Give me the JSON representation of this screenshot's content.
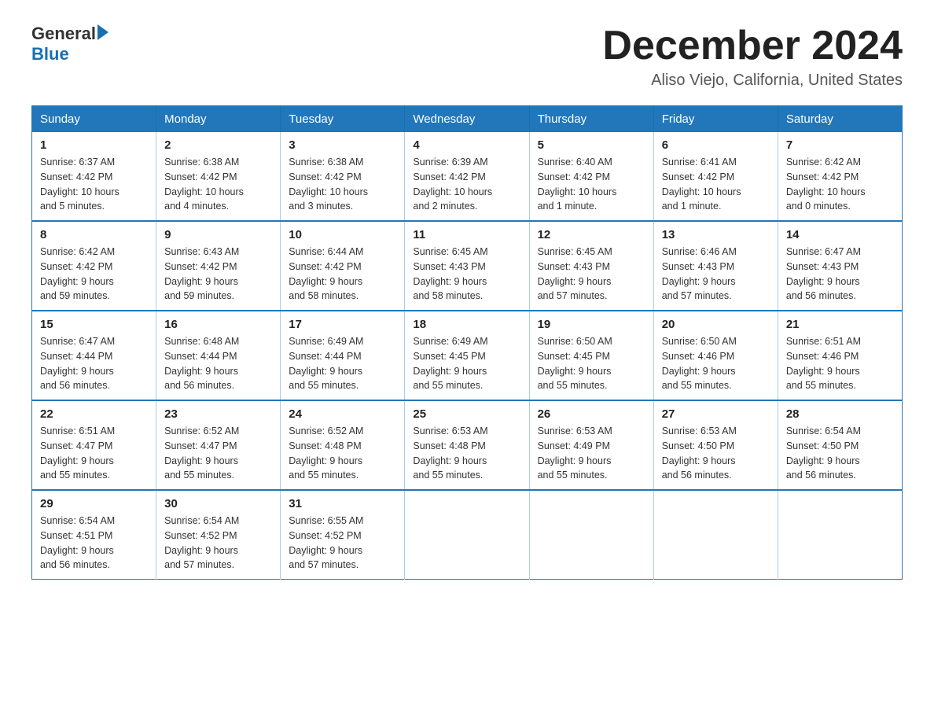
{
  "header": {
    "logo_general": "General",
    "logo_blue": "Blue",
    "month_title": "December 2024",
    "location": "Aliso Viejo, California, United States"
  },
  "weekdays": [
    "Sunday",
    "Monday",
    "Tuesday",
    "Wednesday",
    "Thursday",
    "Friday",
    "Saturday"
  ],
  "weeks": [
    [
      {
        "day": "1",
        "sunrise": "6:37 AM",
        "sunset": "4:42 PM",
        "daylight": "10 hours and 5 minutes."
      },
      {
        "day": "2",
        "sunrise": "6:38 AM",
        "sunset": "4:42 PM",
        "daylight": "10 hours and 4 minutes."
      },
      {
        "day": "3",
        "sunrise": "6:38 AM",
        "sunset": "4:42 PM",
        "daylight": "10 hours and 3 minutes."
      },
      {
        "day": "4",
        "sunrise": "6:39 AM",
        "sunset": "4:42 PM",
        "daylight": "10 hours and 2 minutes."
      },
      {
        "day": "5",
        "sunrise": "6:40 AM",
        "sunset": "4:42 PM",
        "daylight": "10 hours and 1 minute."
      },
      {
        "day": "6",
        "sunrise": "6:41 AM",
        "sunset": "4:42 PM",
        "daylight": "10 hours and 1 minute."
      },
      {
        "day": "7",
        "sunrise": "6:42 AM",
        "sunset": "4:42 PM",
        "daylight": "10 hours and 0 minutes."
      }
    ],
    [
      {
        "day": "8",
        "sunrise": "6:42 AM",
        "sunset": "4:42 PM",
        "daylight": "9 hours and 59 minutes."
      },
      {
        "day": "9",
        "sunrise": "6:43 AM",
        "sunset": "4:42 PM",
        "daylight": "9 hours and 59 minutes."
      },
      {
        "day": "10",
        "sunrise": "6:44 AM",
        "sunset": "4:42 PM",
        "daylight": "9 hours and 58 minutes."
      },
      {
        "day": "11",
        "sunrise": "6:45 AM",
        "sunset": "4:43 PM",
        "daylight": "9 hours and 58 minutes."
      },
      {
        "day": "12",
        "sunrise": "6:45 AM",
        "sunset": "4:43 PM",
        "daylight": "9 hours and 57 minutes."
      },
      {
        "day": "13",
        "sunrise": "6:46 AM",
        "sunset": "4:43 PM",
        "daylight": "9 hours and 57 minutes."
      },
      {
        "day": "14",
        "sunrise": "6:47 AM",
        "sunset": "4:43 PM",
        "daylight": "9 hours and 56 minutes."
      }
    ],
    [
      {
        "day": "15",
        "sunrise": "6:47 AM",
        "sunset": "4:44 PM",
        "daylight": "9 hours and 56 minutes."
      },
      {
        "day": "16",
        "sunrise": "6:48 AM",
        "sunset": "4:44 PM",
        "daylight": "9 hours and 56 minutes."
      },
      {
        "day": "17",
        "sunrise": "6:49 AM",
        "sunset": "4:44 PM",
        "daylight": "9 hours and 55 minutes."
      },
      {
        "day": "18",
        "sunrise": "6:49 AM",
        "sunset": "4:45 PM",
        "daylight": "9 hours and 55 minutes."
      },
      {
        "day": "19",
        "sunrise": "6:50 AM",
        "sunset": "4:45 PM",
        "daylight": "9 hours and 55 minutes."
      },
      {
        "day": "20",
        "sunrise": "6:50 AM",
        "sunset": "4:46 PM",
        "daylight": "9 hours and 55 minutes."
      },
      {
        "day": "21",
        "sunrise": "6:51 AM",
        "sunset": "4:46 PM",
        "daylight": "9 hours and 55 minutes."
      }
    ],
    [
      {
        "day": "22",
        "sunrise": "6:51 AM",
        "sunset": "4:47 PM",
        "daylight": "9 hours and 55 minutes."
      },
      {
        "day": "23",
        "sunrise": "6:52 AM",
        "sunset": "4:47 PM",
        "daylight": "9 hours and 55 minutes."
      },
      {
        "day": "24",
        "sunrise": "6:52 AM",
        "sunset": "4:48 PM",
        "daylight": "9 hours and 55 minutes."
      },
      {
        "day": "25",
        "sunrise": "6:53 AM",
        "sunset": "4:48 PM",
        "daylight": "9 hours and 55 minutes."
      },
      {
        "day": "26",
        "sunrise": "6:53 AM",
        "sunset": "4:49 PM",
        "daylight": "9 hours and 55 minutes."
      },
      {
        "day": "27",
        "sunrise": "6:53 AM",
        "sunset": "4:50 PM",
        "daylight": "9 hours and 56 minutes."
      },
      {
        "day": "28",
        "sunrise": "6:54 AM",
        "sunset": "4:50 PM",
        "daylight": "9 hours and 56 minutes."
      }
    ],
    [
      {
        "day": "29",
        "sunrise": "6:54 AM",
        "sunset": "4:51 PM",
        "daylight": "9 hours and 56 minutes."
      },
      {
        "day": "30",
        "sunrise": "6:54 AM",
        "sunset": "4:52 PM",
        "daylight": "9 hours and 57 minutes."
      },
      {
        "day": "31",
        "sunrise": "6:55 AM",
        "sunset": "4:52 PM",
        "daylight": "9 hours and 57 minutes."
      },
      null,
      null,
      null,
      null
    ]
  ],
  "labels": {
    "sunrise": "Sunrise:",
    "sunset": "Sunset:",
    "daylight": "Daylight:"
  }
}
